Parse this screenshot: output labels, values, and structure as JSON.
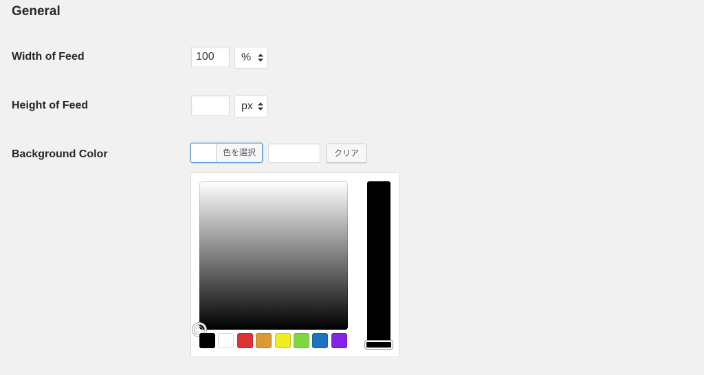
{
  "section": {
    "title": "General"
  },
  "width_row": {
    "label": "Width of Feed",
    "value": "100",
    "unit": "%"
  },
  "height_row": {
    "label": "Height of Feed",
    "value": "",
    "unit": "px"
  },
  "background_row": {
    "label": "Background Color",
    "select_color_label": "色を選択",
    "hex_value": "",
    "clear_label": "クリア",
    "current_color": "#ffffff"
  },
  "picker": {
    "strip_color": "#000000",
    "palette": [
      {
        "name": "black",
        "color": "#000000"
      },
      {
        "name": "white",
        "color": "#ffffff"
      },
      {
        "name": "red",
        "color": "#dd3333"
      },
      {
        "name": "orange",
        "color": "#dd9933"
      },
      {
        "name": "yellow",
        "color": "#eeee22"
      },
      {
        "name": "green",
        "color": "#81d742"
      },
      {
        "name": "blue",
        "color": "#1e73be"
      },
      {
        "name": "purple",
        "color": "#8224e3"
      }
    ]
  }
}
